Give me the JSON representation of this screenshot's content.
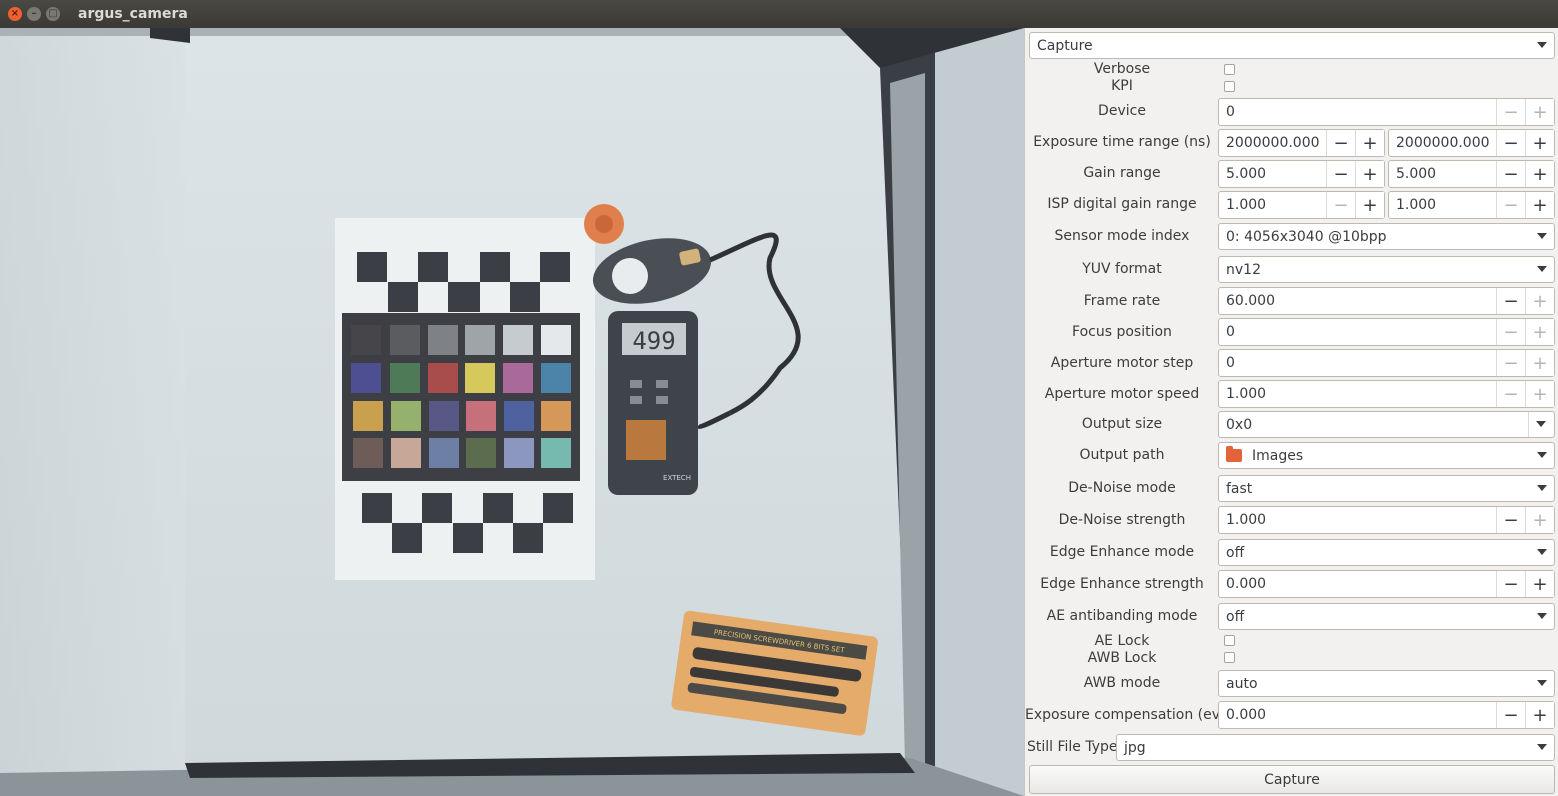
{
  "window": {
    "title": "argus_camera",
    "close_glyph": "×",
    "min_glyph": "–",
    "max_glyph": "□"
  },
  "module_select": {
    "value": "Capture"
  },
  "verbose": {
    "label": "Verbose",
    "checked": false
  },
  "kpi": {
    "label": "KPI",
    "checked": false
  },
  "device": {
    "label": "Device",
    "value": "0"
  },
  "exposure_range": {
    "label": "Exposure time range (ns)",
    "min": "2000000.000",
    "max": "2000000.000"
  },
  "gain_range": {
    "label": "Gain range",
    "min": "5.000",
    "max": "5.000"
  },
  "isp_gain_range": {
    "label": "ISP digital gain range",
    "min": "1.000",
    "max": "1.000"
  },
  "sensor_mode": {
    "label": "Sensor mode index",
    "value": "0: 4056x3040 @10bpp"
  },
  "yuv_format": {
    "label": "YUV format",
    "value": "nv12"
  },
  "frame_rate": {
    "label": "Frame rate",
    "value": "60.000"
  },
  "focus_position": {
    "label": "Focus position",
    "value": "0"
  },
  "aperture_step": {
    "label": "Aperture motor step",
    "value": "0"
  },
  "aperture_speed": {
    "label": "Aperture motor speed",
    "value": "1.000"
  },
  "output_size": {
    "label": "Output size",
    "value": "0x0"
  },
  "output_path": {
    "label": "Output path",
    "value": "Images",
    "icon": "folder-icon"
  },
  "denoise_mode": {
    "label": "De-Noise mode",
    "value": "fast"
  },
  "denoise_strength": {
    "label": "De-Noise strength",
    "value": "1.000"
  },
  "edge_mode": {
    "label": "Edge Enhance mode",
    "value": "off"
  },
  "edge_strength": {
    "label": "Edge Enhance strength",
    "value": "0.000"
  },
  "ae_antibanding": {
    "label": "AE antibanding mode",
    "value": "off"
  },
  "ae_lock": {
    "label": "AE Lock",
    "checked": false
  },
  "awb_lock": {
    "label": "AWB Lock",
    "checked": false
  },
  "awb_mode": {
    "label": "AWB mode",
    "value": "auto"
  },
  "exposure_comp": {
    "label": "Exposure compensation (ev)",
    "value": "0.000"
  },
  "still_file_type": {
    "label": "Still File Type",
    "value": "jpg"
  },
  "capture_button": {
    "label": "Capture"
  },
  "spin_glyphs": {
    "minus": "−",
    "plus": "+"
  },
  "preview": {
    "meter_reading": "499",
    "meter_brand": "EXTECH",
    "box_label": "PRECISION SCREWDRIVER 6 BITS SET"
  },
  "colors": {
    "accent": "#e4633b",
    "titlebar": "#3c3b37",
    "panel": "#f2f1f0"
  }
}
